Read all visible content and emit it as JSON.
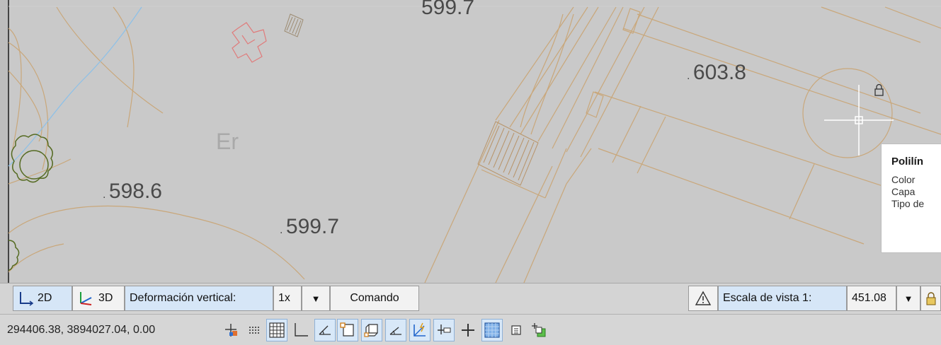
{
  "map": {
    "labels": {
      "e1": "603.8",
      "e2": "598.6",
      "e3": "599.7",
      "e4": "599.7",
      "zone": "Er"
    }
  },
  "tooltip": {
    "title": "Polilín",
    "rows": [
      "Color",
      "Capa",
      "Tipo de"
    ]
  },
  "statusbar": {
    "btn_2d": "2D",
    "btn_3d": "3D",
    "vertical_label": "Deformación vertical:",
    "vertical_value": "1x",
    "command_label": "Comando",
    "scale_label": "Escala de vista 1:",
    "scale_value": "451.08"
  },
  "toolbar": {
    "coordinates": "294406.38, 3894027.04, 0.00"
  },
  "colors": {
    "contour": "#c9a77a",
    "building": "#e07b7b",
    "tree": "#556b22",
    "water": "#8cc0e8"
  }
}
